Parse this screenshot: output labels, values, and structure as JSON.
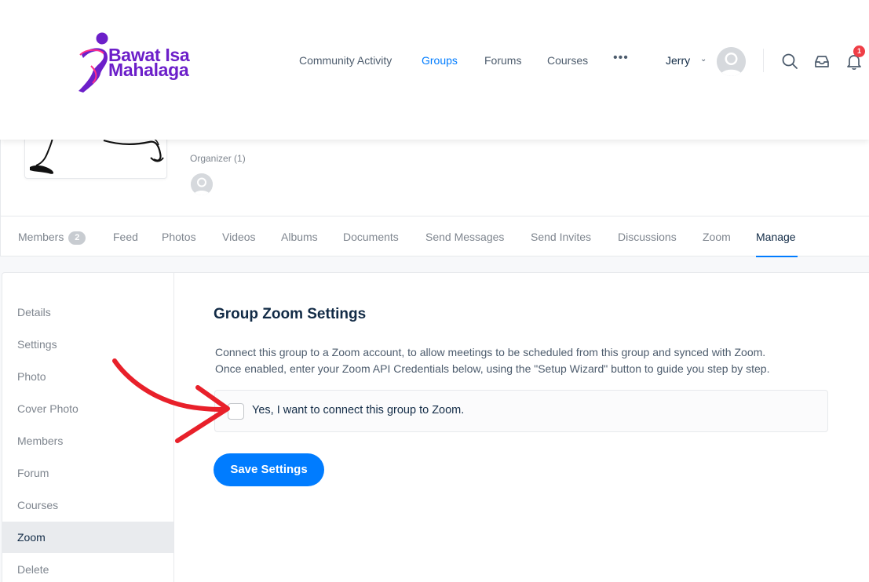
{
  "brand": {
    "line1": "Bawat Isa",
    "line2": "Mahalaga",
    "color": "#6c1fc9"
  },
  "nav": {
    "items": [
      {
        "label": "Community Activity",
        "active": false
      },
      {
        "label": "Groups",
        "active": true
      },
      {
        "label": "Forums",
        "active": false
      },
      {
        "label": "Courses",
        "active": false
      }
    ],
    "more": "•••"
  },
  "user": {
    "name": "Jerry",
    "notifications": "1"
  },
  "group": {
    "organizer_label": "Organizer (1)"
  },
  "tabs": [
    {
      "label": "Members",
      "count": "2"
    },
    {
      "label": "Feed"
    },
    {
      "label": "Photos"
    },
    {
      "label": "Videos"
    },
    {
      "label": "Albums"
    },
    {
      "label": "Documents"
    },
    {
      "label": "Send Messages"
    },
    {
      "label": "Send Invites"
    },
    {
      "label": "Discussions"
    },
    {
      "label": "Zoom"
    },
    {
      "label": "Manage",
      "active": true
    }
  ],
  "sidebar": {
    "items": [
      {
        "label": "Details"
      },
      {
        "label": "Settings"
      },
      {
        "label": "Photo"
      },
      {
        "label": "Cover Photo"
      },
      {
        "label": "Members"
      },
      {
        "label": "Forum"
      },
      {
        "label": "Courses"
      },
      {
        "label": "Zoom",
        "active": true
      },
      {
        "label": "Delete"
      }
    ]
  },
  "zoom_settings": {
    "title": "Group Zoom Settings",
    "description_line1": "Connect this group to a Zoom account, to allow meetings to be scheduled from this group and synced with Zoom.",
    "description_line2": "Once enabled, enter your Zoom API Credentials below, using the \"Setup Wizard\" button to guide you step by step.",
    "checkbox_label": "Yes, I want to connect this group to Zoom.",
    "checkbox_checked": false,
    "save_label": "Save Settings"
  },
  "colors": {
    "accent": "#007cff",
    "badge": "#ef3e46",
    "annotation_arrow": "#e8202a"
  }
}
